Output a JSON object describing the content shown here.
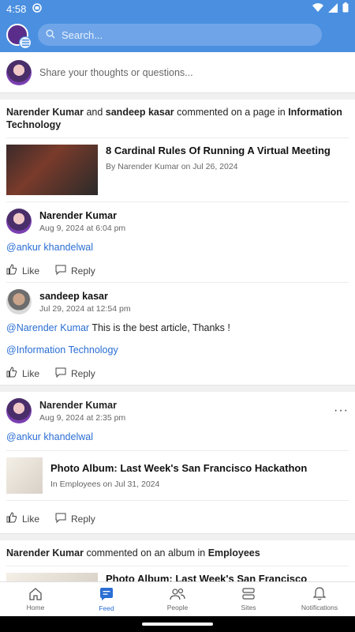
{
  "status": {
    "time": "4:58"
  },
  "search": {
    "placeholder": "Search..."
  },
  "composer": {
    "placeholder": "Share your thoughts or questions..."
  },
  "activity1": {
    "actor1": "Narender Kumar",
    "joiner": "and",
    "actor2": "sandeep kasar",
    "verb": "commented on a page in",
    "target": "Information Technology",
    "doc": {
      "title": "8 Cardinal Rules Of Running A Virtual Meeting",
      "meta": "By Narender Kumar on Jul 26, 2024"
    },
    "comments": [
      {
        "name": "Narender Kumar",
        "date": "Aug 9, 2024 at 6:04 pm",
        "mention": "@ankur khandelwal",
        "text": "",
        "mention2": "",
        "like": "Like",
        "reply": "Reply"
      },
      {
        "name": "sandeep kasar",
        "date": "Jul 29, 2024 at 12:54 pm",
        "mention": "@Narender Kumar",
        "text": " This is the best article, Thanks !",
        "mention2": "@Information Technology",
        "like": "Like",
        "reply": "Reply"
      }
    ]
  },
  "post2": {
    "name": "Narender Kumar",
    "date": "Aug 9, 2024 at 2:35 pm",
    "mention": "@ankur khandelwal",
    "more": "···",
    "doc": {
      "title": "Photo Album: Last Week's San Francisco Hackathon",
      "meta": "In Employees on Jul 31, 2024"
    },
    "like": "Like",
    "reply": "Reply"
  },
  "activity3": {
    "actor": "Narender Kumar",
    "verb": "commented on an album in",
    "target": "Employees",
    "doc_title": "Photo Album: Last Week's San Francisco Hackathon"
  },
  "nav": [
    {
      "label": "Home",
      "icon": "home-icon"
    },
    {
      "label": "Feed",
      "icon": "feed-icon"
    },
    {
      "label": "People",
      "icon": "people-icon"
    },
    {
      "label": "Sites",
      "icon": "sites-icon"
    },
    {
      "label": "Notifications",
      "icon": "bell-icon"
    }
  ],
  "colors": {
    "brand": "#4a8fe0",
    "link": "#2a6ed4"
  }
}
